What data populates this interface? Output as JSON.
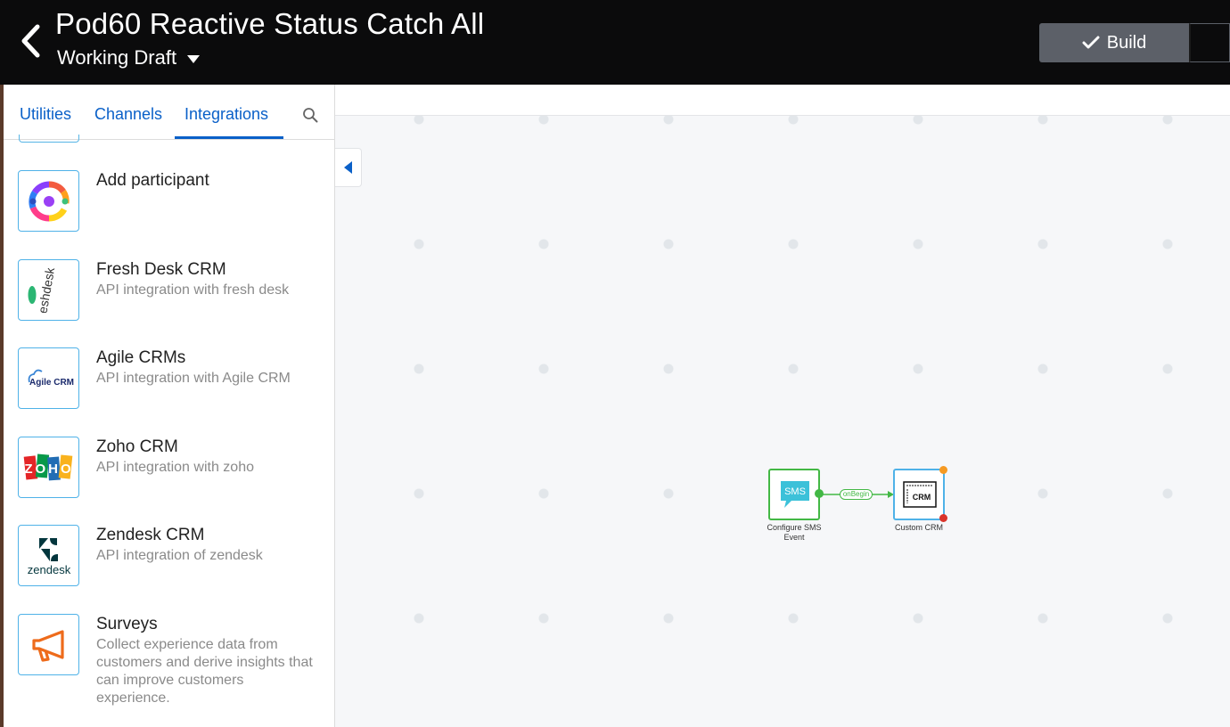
{
  "header": {
    "title": "Pod60 Reactive Status Catch All",
    "version": "Working Draft",
    "build_label": "Build"
  },
  "tabs": [
    {
      "label": "Utilities"
    },
    {
      "label": "Channels"
    },
    {
      "label": "Integrations",
      "active": true
    }
  ],
  "items": [
    {
      "title": "Add participant",
      "desc": "",
      "icon": "add-participant-logo"
    },
    {
      "title": "Fresh Desk CRM",
      "desc": "API integration with fresh desk",
      "icon": "freshdesk-logo",
      "logo_text": "freshdesk"
    },
    {
      "title": "Agile CRMs",
      "desc": "API integration with Agile CRM",
      "icon": "agile-crm-logo",
      "logo_text": "Agile CRM"
    },
    {
      "title": "Zoho CRM",
      "desc": "API integration with zoho",
      "icon": "zoho-logo",
      "logo_text": "ZOHO"
    },
    {
      "title": "Zendesk CRM",
      "desc": "API integration of zendesk",
      "icon": "zendesk-logo",
      "logo_text": "zendesk"
    },
    {
      "title": "Surveys",
      "desc": "Collect experience data from customers and derive insights that can improve customers experience.",
      "icon": "megaphone-icon"
    }
  ],
  "flow": {
    "nodes": [
      {
        "id": "sms",
        "label": "Configure SMS Event",
        "icon_text": "SMS"
      },
      {
        "id": "crm",
        "label": "Custom CRM",
        "icon_text": "CRM"
      }
    ],
    "edge_label": "onBegin"
  },
  "colors": {
    "accent": "#0a60c8",
    "item_border": "#4fb2e8",
    "success_green": "#43b845",
    "node_blue": "#4fb2e8",
    "error_red": "#d9342b",
    "warning_orange": "#f59a23"
  }
}
